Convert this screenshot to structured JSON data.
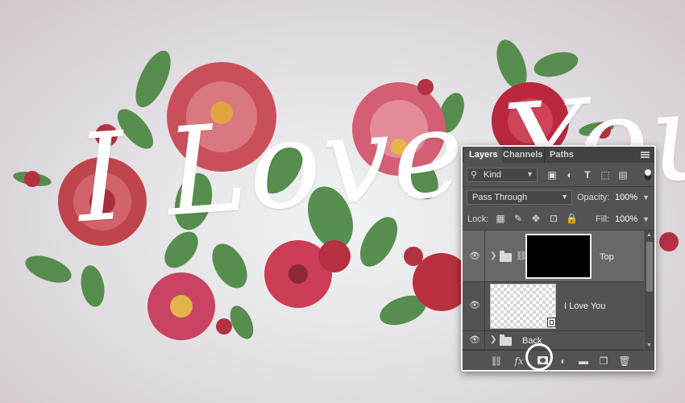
{
  "artwork": {
    "text": "I Love You"
  },
  "panel": {
    "tabs": [
      {
        "label": "Layers",
        "active": true
      },
      {
        "label": "Channels",
        "active": false
      },
      {
        "label": "Paths",
        "active": false
      }
    ],
    "filter": {
      "kind_label": "Kind"
    },
    "blend_mode": "Pass Through",
    "opacity_label": "Opacity:",
    "opacity_value": "100%",
    "lock_label": "Lock:",
    "fill_label": "Fill:",
    "fill_value": "100%",
    "layers": [
      {
        "name": "Top",
        "type": "group",
        "selected": true,
        "visible": true
      },
      {
        "name": "I Love You",
        "type": "smart-object",
        "selected": false,
        "visible": true
      },
      {
        "name": "Back",
        "type": "group",
        "selected": false,
        "visible": true
      }
    ],
    "bottom_tools": [
      "link-icon",
      "fx-icon",
      "add-mask-icon",
      "adjustment-icon",
      "folder-icon",
      "new-layer-icon",
      "trash-icon"
    ]
  },
  "colors": {
    "panel_bg": "#535353",
    "tab_bg": "#424242",
    "selected_layer": "#686868",
    "rose_red": "#c33a48",
    "leaf_green": "#4f8a45"
  }
}
